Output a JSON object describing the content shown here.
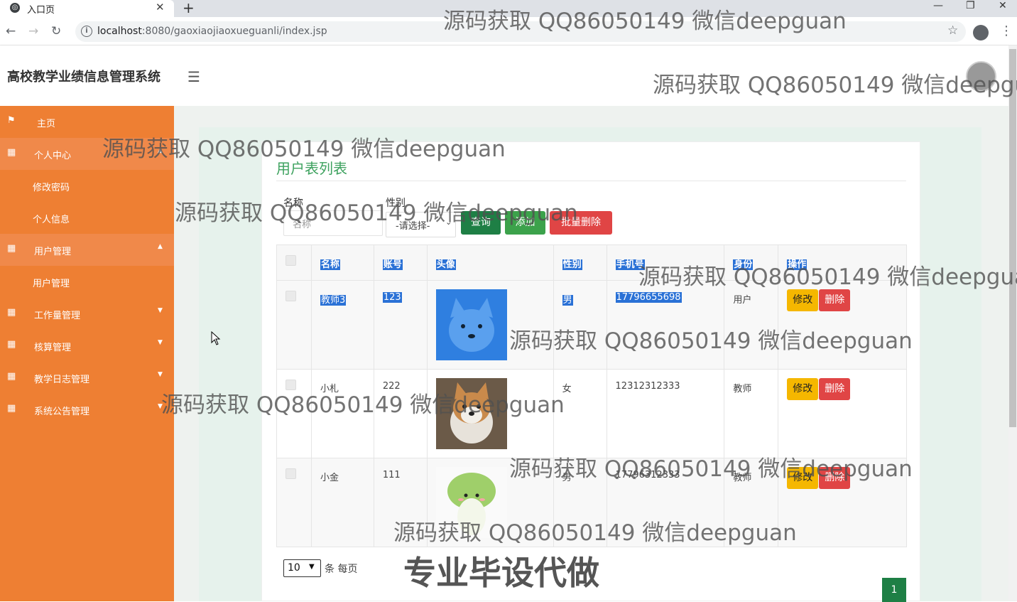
{
  "browser": {
    "tab_title": "入口页",
    "url_host": "localhost",
    "url_path": ":8080/gaoxiaojiaoxueguanli/index.jsp",
    "new_tab": "+",
    "close": "✕"
  },
  "header": {
    "title": "高校教学业绩信息管理系统"
  },
  "sidebar": {
    "items": [
      {
        "label": "主页",
        "icon": "flag-icon"
      },
      {
        "label": "个人中心",
        "icon": "grid-icon"
      },
      {
        "label": "修改密码"
      },
      {
        "label": "个人信息"
      },
      {
        "label": "用户管理",
        "icon": "grid-icon"
      },
      {
        "label": "用户管理"
      },
      {
        "label": "工作量管理",
        "icon": "grid-icon"
      },
      {
        "label": "核算管理",
        "icon": "grid-icon"
      },
      {
        "label": "教学日志管理",
        "icon": "grid-icon"
      },
      {
        "label": "系统公告管理",
        "icon": "grid-icon"
      }
    ]
  },
  "page": {
    "title": "用户表列表",
    "name_label": "名称",
    "name_placeholder": "名称",
    "gender_label": "性别",
    "gender_selected": "-请选择-",
    "query_btn": "查询",
    "add_btn": "添加",
    "bulk_delete_btn": "批量删除"
  },
  "table": {
    "headers": [
      "名称",
      "账号",
      "头像",
      "性别",
      "手机号",
      "身份",
      "操作"
    ],
    "rows": [
      {
        "name": "教师3",
        "account": "123",
        "gender": "男",
        "phone": "17796655698",
        "role": "用户",
        "edit": "修改",
        "delete": "删除"
      },
      {
        "name": "小札",
        "account": "222",
        "gender": "女",
        "phone": "12312312333",
        "role": "教师",
        "edit": "修改",
        "delete": "删除"
      },
      {
        "name": "小金",
        "account": "111",
        "gender": "男",
        "phone": "17796312333",
        "role": "教师",
        "edit": "修改",
        "delete": "删除"
      }
    ]
  },
  "footer": {
    "page_size": "10",
    "per_page_label": "条 每页",
    "current_page": "1"
  },
  "watermarks": {
    "text": "源码获取 QQ86050149 微信deepguan",
    "big": "专业毕设代做"
  },
  "colors": {
    "sidebar": "#ee7f33",
    "title_green": "#3ea25f",
    "query": "#1e7f45",
    "add": "#3ca24b",
    "danger": "#e04545",
    "edit": "#f5b700"
  }
}
